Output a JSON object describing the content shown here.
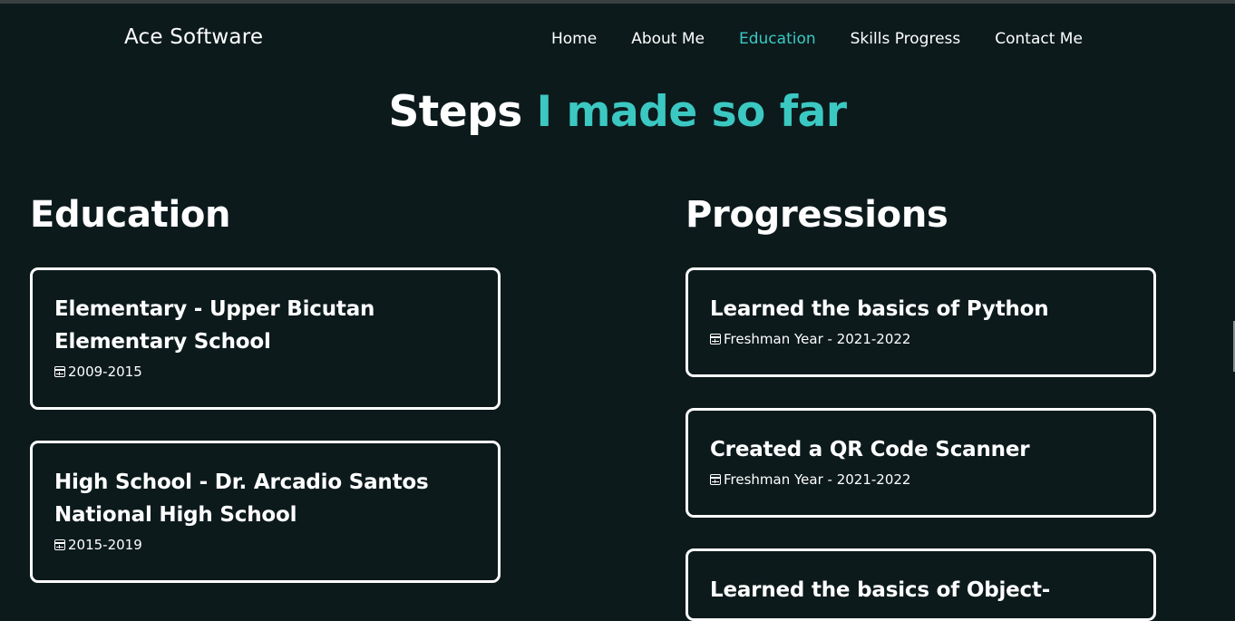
{
  "navbar": {
    "brand": "Ace Software",
    "links": [
      {
        "label": "Home",
        "active": false
      },
      {
        "label": "About Me",
        "active": false
      },
      {
        "label": "Education",
        "active": true
      },
      {
        "label": "Skills Progress",
        "active": false
      },
      {
        "label": "Contact Me",
        "active": false
      }
    ]
  },
  "hero": {
    "title_plain": "Steps",
    "title_accent": "I made so far"
  },
  "education": {
    "heading": "Education",
    "items": [
      {
        "title": "Elementary - Upper Bicutan Elementary School",
        "date": "2009-2015"
      },
      {
        "title": "High School - Dr. Arcadio Santos National High School",
        "date": "2015-2019"
      }
    ]
  },
  "progressions": {
    "heading": "Progressions",
    "items": [
      {
        "title": "Learned the basics of Python",
        "date": "Freshman Year - 2021-2022"
      },
      {
        "title": "Created a QR Code Scanner",
        "date": "Freshman Year - 2021-2022"
      },
      {
        "title": "Learned the basics of Object-",
        "date": ""
      }
    ]
  },
  "colors": {
    "background": "#0c1a1c",
    "accent": "#3cc8c2",
    "text": "#ffffff"
  },
  "icons": {
    "date": "calendar-icon"
  }
}
